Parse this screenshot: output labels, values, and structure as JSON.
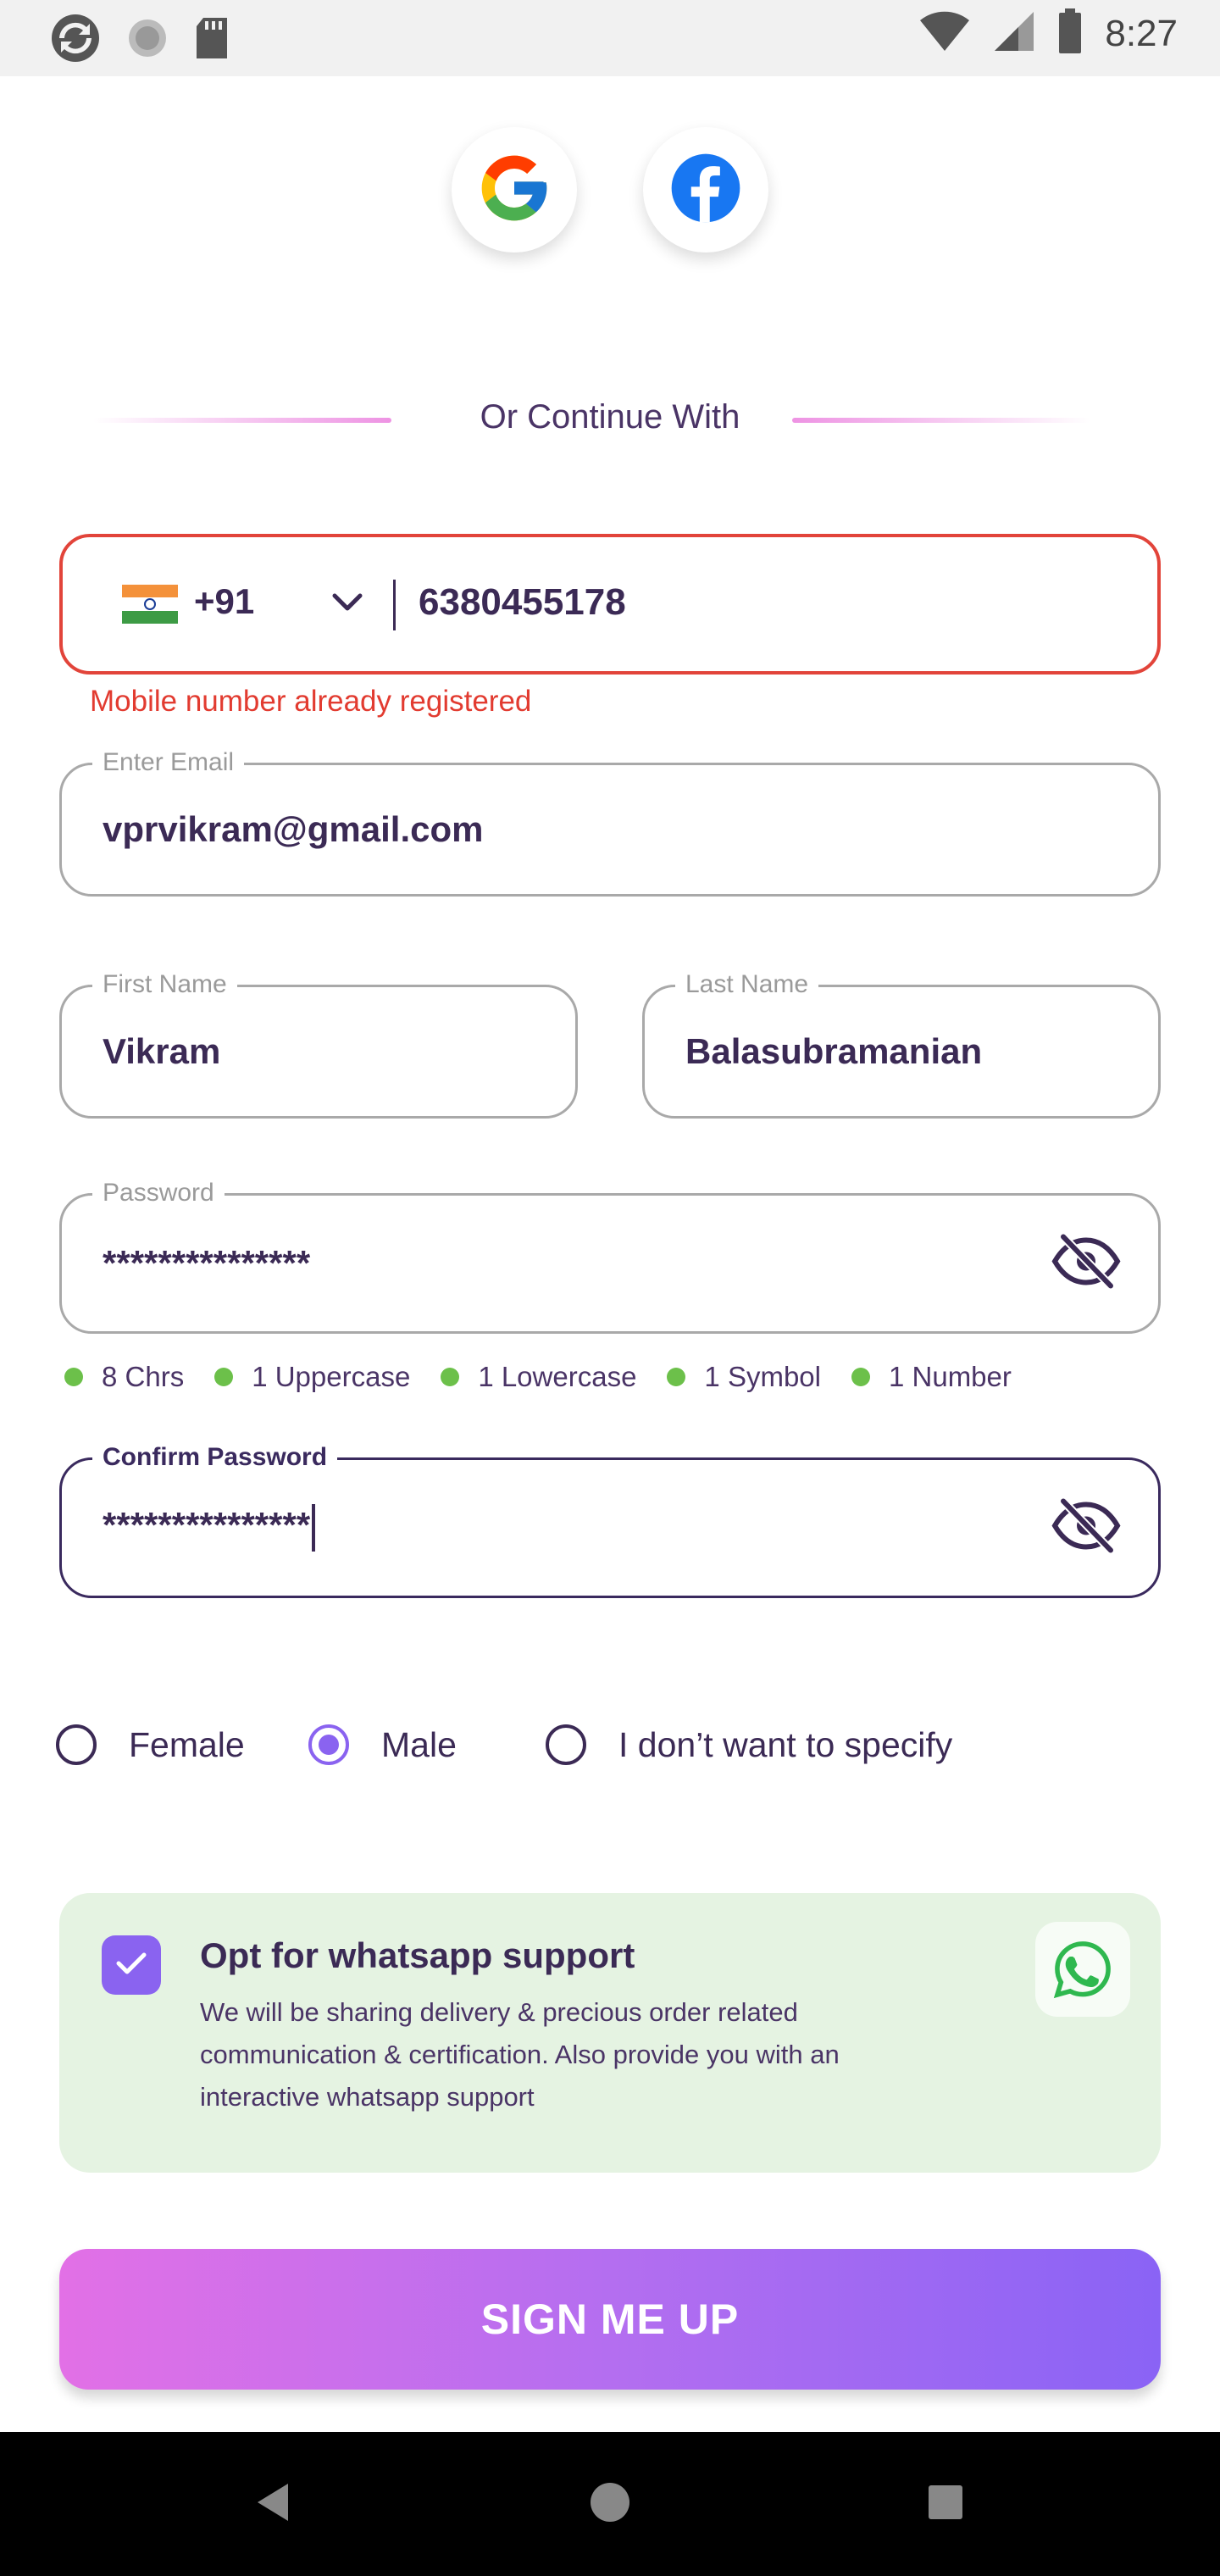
{
  "status_bar": {
    "time": "8:27",
    "icons": [
      "sync-icon",
      "loading-icon",
      "sd-card-icon",
      "wifi-icon",
      "signal-icon",
      "battery-icon"
    ]
  },
  "social": {
    "google_icon": "google-icon",
    "facebook_icon": "facebook-icon"
  },
  "divider": {
    "text": "Or Continue With"
  },
  "phone": {
    "flag": "india-flag-icon",
    "country_code": "+91",
    "number": "6380455178",
    "error": "Mobile number already registered"
  },
  "email": {
    "label": "Enter Email",
    "value": "vprvikram@gmail.com"
  },
  "first_name": {
    "label": "First Name",
    "value": "Vikram"
  },
  "last_name": {
    "label": "Last Name",
    "value": "Balasubramanian"
  },
  "password": {
    "label": "Password",
    "value": "***************"
  },
  "password_rules": [
    "8 Chrs",
    "1 Uppercase",
    "1 Lowercase",
    "1 Symbol",
    "1 Number"
  ],
  "confirm_password": {
    "label": "Confirm Password",
    "value": "***************"
  },
  "gender": {
    "options": [
      "Female",
      "Male",
      "I don’t want to specify"
    ],
    "selected": "Male"
  },
  "whatsapp": {
    "checked": true,
    "title": "Opt for whatsapp support",
    "description": "We will be sharing delivery & precious order related communication & certification. Also provide you with an interactive whatsapp support"
  },
  "signup_label": "SIGN ME UP",
  "colors": {
    "error": "#e2443a",
    "accent_purple": "#8a63f0",
    "text_dark": "#3b2a55",
    "rule_dot_green": "#6cc04a",
    "whatsapp_card_bg": "#e5f3e2"
  }
}
